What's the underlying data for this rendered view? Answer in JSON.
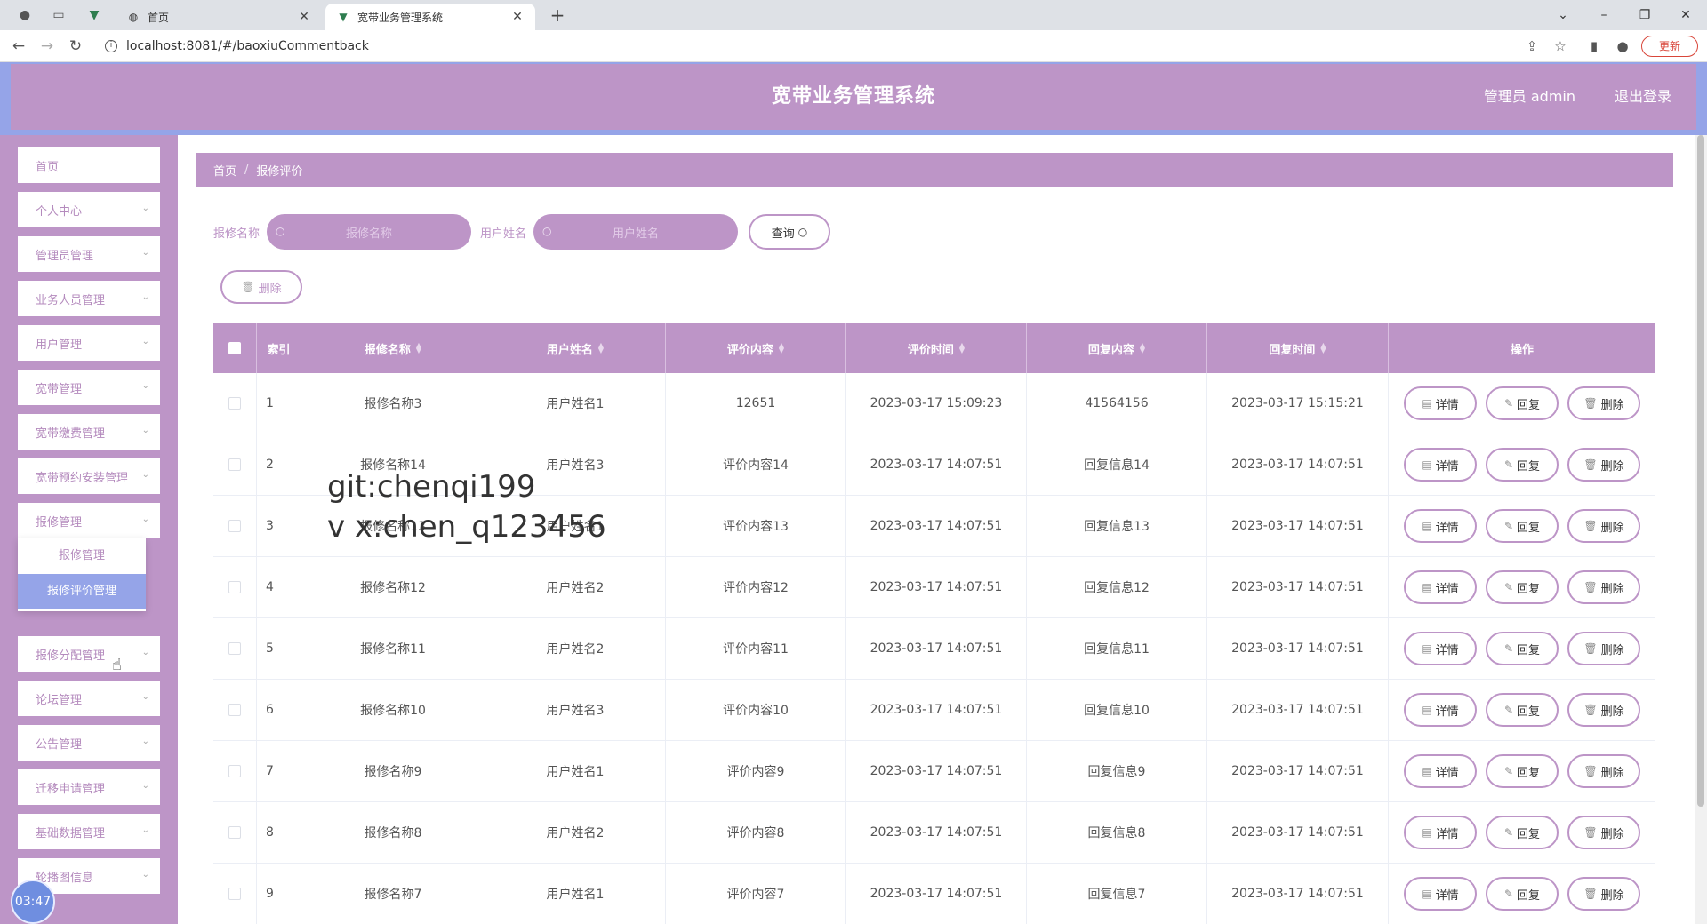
{
  "browser": {
    "tabs": [
      {
        "title": "首页"
      },
      {
        "title": "宽带业务管理系统"
      }
    ],
    "url": "localhost:8081/#/baoxiuCommentback",
    "update_label": "更新"
  },
  "header": {
    "title": "宽带业务管理系统",
    "admin": "管理员 admin",
    "logout": "退出登录"
  },
  "sidebar": {
    "items": [
      {
        "label": "首页",
        "has_children": false
      },
      {
        "label": "个人中心",
        "has_children": true
      },
      {
        "label": "管理员管理",
        "has_children": true
      },
      {
        "label": "业务人员管理",
        "has_children": true
      },
      {
        "label": "用户管理",
        "has_children": true
      },
      {
        "label": "宽带管理",
        "has_children": true
      },
      {
        "label": "宽带缴费管理",
        "has_children": true
      },
      {
        "label": "宽带预约安装管理",
        "has_children": true
      },
      {
        "label": "报修管理",
        "has_children": true
      },
      {
        "label": "报修分配管理",
        "has_children": true
      },
      {
        "label": "论坛管理",
        "has_children": true
      },
      {
        "label": "公告管理",
        "has_children": true
      },
      {
        "label": "迁移申请管理",
        "has_children": true
      },
      {
        "label": "基础数据管理",
        "has_children": true
      },
      {
        "label": "轮播图信息",
        "has_children": true
      }
    ],
    "submenu": [
      {
        "label": "报修管理"
      },
      {
        "label": "报修评价管理"
      }
    ],
    "clock": "03:47"
  },
  "breadcrumb": {
    "home": "首页",
    "current": "报修评价"
  },
  "search": {
    "name_label": "报修名称",
    "name_placeholder": "报修名称",
    "user_label": "用户姓名",
    "user_placeholder": "用户姓名",
    "query_label": "查询"
  },
  "batch_delete_label": "删除",
  "table": {
    "headers": [
      "索引",
      "报修名称",
      "用户姓名",
      "评价内容",
      "评价时间",
      "回复内容",
      "回复时间",
      "操作"
    ],
    "actions": {
      "detail": "详情",
      "reply": "回复",
      "delete": "删除"
    },
    "rows": [
      {
        "index": "1",
        "name": "报修名称3",
        "user": "用户姓名1",
        "content": "12651",
        "time": "2023-03-17 15:09:23",
        "reply": "41564156",
        "reply_time": "2023-03-17 15:15:21"
      },
      {
        "index": "2",
        "name": "报修名称14",
        "user": "用户姓名3",
        "content": "评价内容14",
        "time": "2023-03-17 14:07:51",
        "reply": "回复信息14",
        "reply_time": "2023-03-17 14:07:51"
      },
      {
        "index": "3",
        "name": "报修名称13",
        "user": "用户姓名1",
        "content": "评价内容13",
        "time": "2023-03-17 14:07:51",
        "reply": "回复信息13",
        "reply_time": "2023-03-17 14:07:51"
      },
      {
        "index": "4",
        "name": "报修名称12",
        "user": "用户姓名2",
        "content": "评价内容12",
        "time": "2023-03-17 14:07:51",
        "reply": "回复信息12",
        "reply_time": "2023-03-17 14:07:51"
      },
      {
        "index": "5",
        "name": "报修名称11",
        "user": "用户姓名2",
        "content": "评价内容11",
        "time": "2023-03-17 14:07:51",
        "reply": "回复信息11",
        "reply_time": "2023-03-17 14:07:51"
      },
      {
        "index": "6",
        "name": "报修名称10",
        "user": "用户姓名3",
        "content": "评价内容10",
        "time": "2023-03-17 14:07:51",
        "reply": "回复信息10",
        "reply_time": "2023-03-17 14:07:51"
      },
      {
        "index": "7",
        "name": "报修名称9",
        "user": "用户姓名1",
        "content": "评价内容9",
        "time": "2023-03-17 14:07:51",
        "reply": "回复信息9",
        "reply_time": "2023-03-17 14:07:51"
      },
      {
        "index": "8",
        "name": "报修名称8",
        "user": "用户姓名2",
        "content": "评价内容8",
        "time": "2023-03-17 14:07:51",
        "reply": "回复信息8",
        "reply_time": "2023-03-17 14:07:51"
      },
      {
        "index": "9",
        "name": "报修名称7",
        "user": "用户姓名1",
        "content": "评价内容7",
        "time": "2023-03-17 14:07:51",
        "reply": "回复信息7",
        "reply_time": "2023-03-17 14:07:51"
      }
    ]
  },
  "watermark": {
    "line1": "git:chenqi199",
    "line2": "v x:chen_q123456"
  },
  "colors": {
    "primary": "#bd95c7",
    "accent": "#95a4e8"
  }
}
